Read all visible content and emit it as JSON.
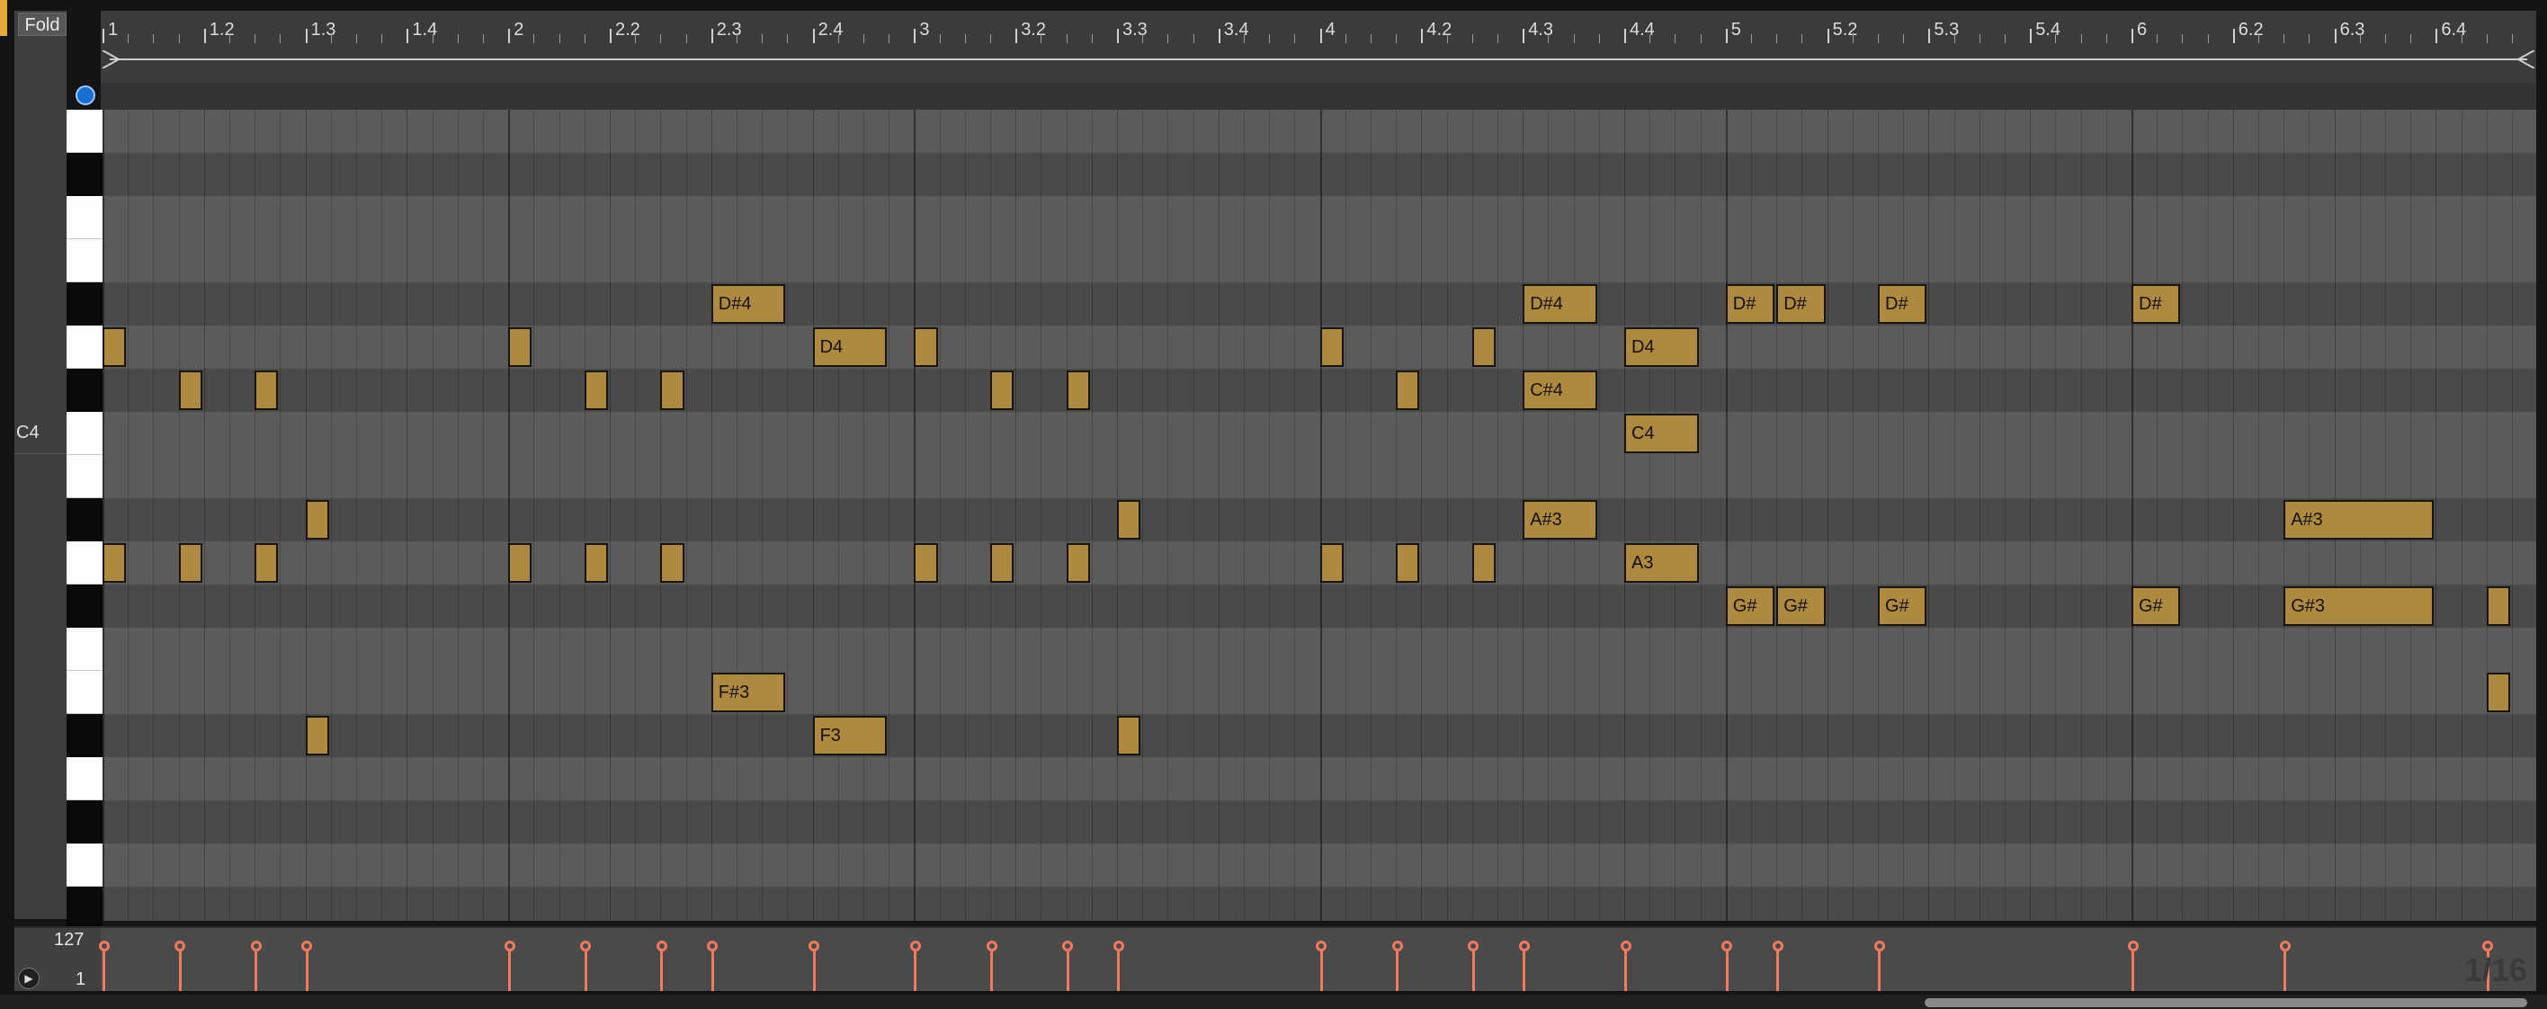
{
  "panel": {
    "fold_label": "Fold",
    "pitch_label": "C4"
  },
  "ruler": {
    "labels": [
      "1",
      "1.2",
      "1.3",
      "1.4",
      "2",
      "2.2",
      "2.3",
      "2.4",
      "3",
      "3.2",
      "3.3",
      "3.4",
      "4",
      "4.2",
      "4.3",
      "4.4",
      "5",
      "5.2",
      "5.3",
      "5.4",
      "6",
      "6.2",
      "6.3",
      "6.4"
    ]
  },
  "velocity": {
    "max_label": "127",
    "min_label": "1"
  },
  "grid_value": "1/16",
  "notes": [
    {
      "label": "",
      "lane": 5,
      "start": 0,
      "len": 1
    },
    {
      "label": "",
      "lane": 6,
      "start": 3,
      "len": 1
    },
    {
      "label": "",
      "lane": 6,
      "start": 6,
      "len": 1
    },
    {
      "label": "",
      "lane": 9,
      "start": 8,
      "len": 1
    },
    {
      "label": "",
      "lane": 10,
      "start": 0,
      "len": 1
    },
    {
      "label": "",
      "lane": 10,
      "start": 3,
      "len": 1
    },
    {
      "label": "",
      "lane": 10,
      "start": 6,
      "len": 1
    },
    {
      "label": "",
      "lane": 14,
      "start": 8,
      "len": 1
    },
    {
      "label": "",
      "lane": 5,
      "start": 16,
      "len": 1
    },
    {
      "label": "",
      "lane": 6,
      "start": 19,
      "len": 1
    },
    {
      "label": "",
      "lane": 6,
      "start": 22,
      "len": 1
    },
    {
      "label": "",
      "lane": 10,
      "start": 16,
      "len": 1
    },
    {
      "label": "",
      "lane": 10,
      "start": 19,
      "len": 1
    },
    {
      "label": "",
      "lane": 10,
      "start": 22,
      "len": 1
    },
    {
      "label": "D#4",
      "lane": 4,
      "start": 24,
      "len": 3
    },
    {
      "label": "F#3",
      "lane": 13,
      "start": 24,
      "len": 3
    },
    {
      "label": "D4",
      "lane": 5,
      "start": 28,
      "len": 3
    },
    {
      "label": "F3",
      "lane": 14,
      "start": 28,
      "len": 3
    },
    {
      "label": "",
      "lane": 5,
      "start": 32,
      "len": 1
    },
    {
      "label": "",
      "lane": 6,
      "start": 35,
      "len": 1
    },
    {
      "label": "",
      "lane": 6,
      "start": 38,
      "len": 1
    },
    {
      "label": "",
      "lane": 9,
      "start": 40,
      "len": 1
    },
    {
      "label": "",
      "lane": 10,
      "start": 32,
      "len": 1
    },
    {
      "label": "",
      "lane": 10,
      "start": 35,
      "len": 1
    },
    {
      "label": "",
      "lane": 10,
      "start": 38,
      "len": 1
    },
    {
      "label": "",
      "lane": 14,
      "start": 40,
      "len": 1
    },
    {
      "label": "",
      "lane": 5,
      "start": 48,
      "len": 1
    },
    {
      "label": "",
      "lane": 6,
      "start": 51,
      "len": 1
    },
    {
      "label": "",
      "lane": 5,
      "start": 54,
      "len": 1
    },
    {
      "label": "",
      "lane": 10,
      "start": 48,
      "len": 1
    },
    {
      "label": "",
      "lane": 10,
      "start": 51,
      "len": 1
    },
    {
      "label": "",
      "lane": 10,
      "start": 54,
      "len": 1
    },
    {
      "label": "D#4",
      "lane": 4,
      "start": 56,
      "len": 3
    },
    {
      "label": "C#4",
      "lane": 6,
      "start": 56,
      "len": 3
    },
    {
      "label": "A#3",
      "lane": 9,
      "start": 56,
      "len": 3
    },
    {
      "label": "D4",
      "lane": 5,
      "start": 60,
      "len": 3
    },
    {
      "label": "C4",
      "lane": 7,
      "start": 60,
      "len": 3
    },
    {
      "label": "A3",
      "lane": 10,
      "start": 60,
      "len": 3
    },
    {
      "label": "D#",
      "lane": 4,
      "start": 64,
      "len": 2
    },
    {
      "label": "G#",
      "lane": 11,
      "start": 64,
      "len": 2
    },
    {
      "label": "D#",
      "lane": 4,
      "start": 66,
      "len": 2
    },
    {
      "label": "G#",
      "lane": 11,
      "start": 66,
      "len": 2
    },
    {
      "label": "D#",
      "lane": 4,
      "start": 70,
      "len": 2
    },
    {
      "label": "G#",
      "lane": 11,
      "start": 70,
      "len": 2
    },
    {
      "label": "D#",
      "lane": 4,
      "start": 80,
      "len": 2
    },
    {
      "label": "G#",
      "lane": 11,
      "start": 80,
      "len": 2
    },
    {
      "label": "A#3",
      "lane": 9,
      "start": 86,
      "len": 6
    },
    {
      "label": "G#3",
      "lane": 11,
      "start": 86,
      "len": 6
    },
    {
      "label": "",
      "lane": 11,
      "start": 94,
      "len": 1
    },
    {
      "label": "",
      "lane": 13,
      "start": 94,
      "len": 1
    }
  ],
  "velocities_at": [
    0,
    3,
    6,
    8,
    16,
    19,
    22,
    24,
    28,
    32,
    35,
    38,
    40,
    48,
    51,
    54,
    56,
    60,
    64,
    66,
    70,
    80,
    86,
    94
  ]
}
